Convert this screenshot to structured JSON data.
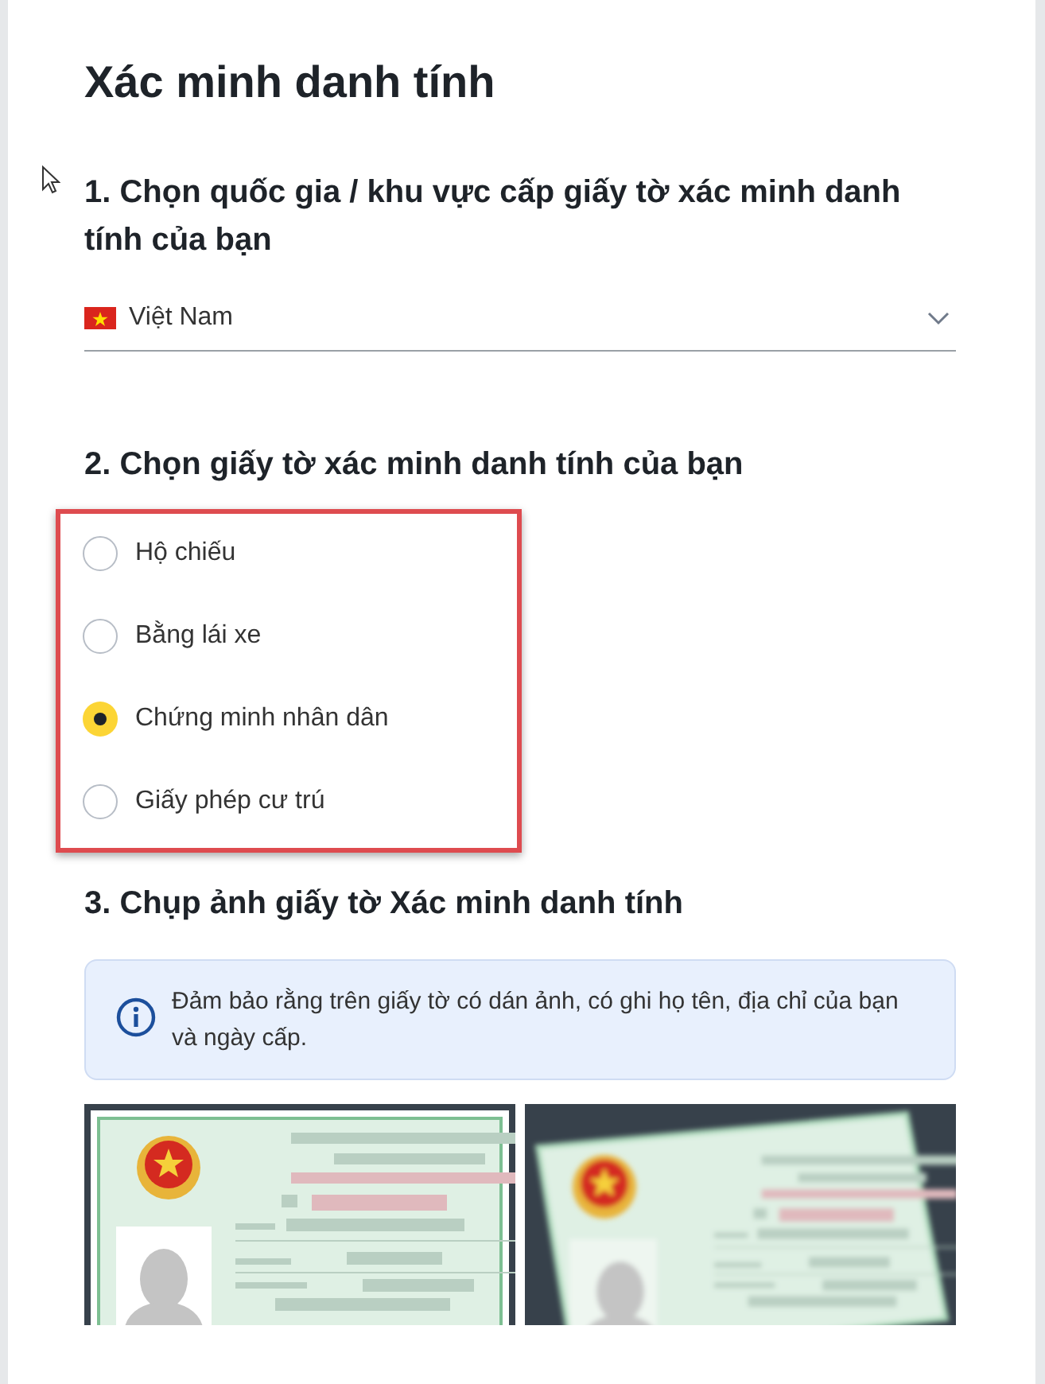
{
  "title": "Xác minh danh tính",
  "country_section": {
    "heading": "1. Chọn quốc gia / khu vực cấp giấy tờ xác minh danh tính của bạn",
    "select": {
      "value": "Việt Nam"
    }
  },
  "document_section": {
    "heading": "2. Chọn giấy tờ xác minh danh tính của bạn",
    "options": [
      {
        "label": "Hộ chiếu",
        "selected": false
      },
      {
        "label": "Bằng lái xe",
        "selected": false
      },
      {
        "label": "Chứng minh nhân dân",
        "selected": true
      },
      {
        "label": "Giấy phép cư trú",
        "selected": false
      }
    ]
  },
  "photo_section": {
    "heading": "3. Chụp ảnh giấy tờ Xác minh danh tính",
    "info": "Đảm bảo rằng trên giấy tờ có dán ảnh, có ghi họ tên, địa chỉ của bạn và ngày cấp.",
    "samples": [
      {
        "kind": "straight"
      },
      {
        "kind": "tilted"
      }
    ]
  }
}
